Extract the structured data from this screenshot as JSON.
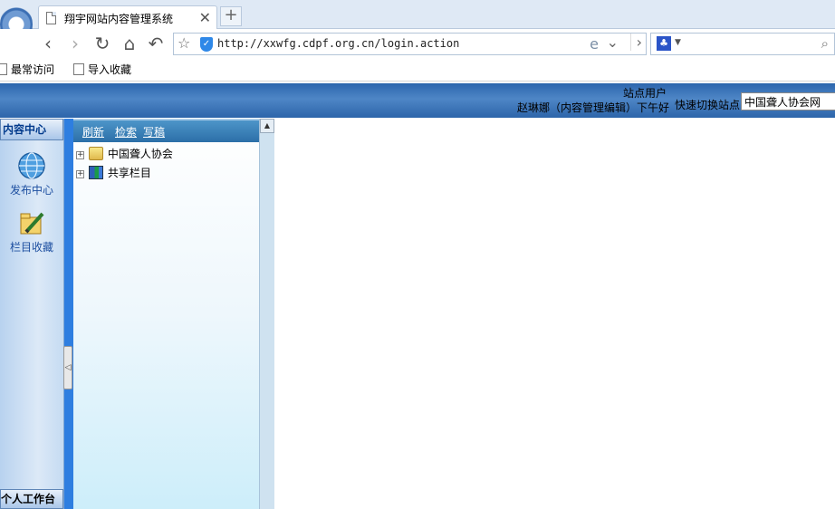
{
  "browser": {
    "tab_title": "翔宇网站内容管理系统",
    "tab_close": "✕",
    "new_tab": "+",
    "url": "http://xxwfg.cdpf.org.cn/login.action",
    "nav": {
      "back": "‹",
      "forward": "›",
      "reload": "↻",
      "home": "⌂",
      "undo": "↶"
    },
    "bookmarks": [
      "最常访问",
      "导入收藏"
    ]
  },
  "header": {
    "user_label": "站点用户",
    "greeting": "赵琳娜（内容管理编辑）下午好",
    "switch_label": "快速切换站点",
    "site_selected": "中国聋人协会网"
  },
  "left_rail": {
    "title": "内容中心",
    "items": [
      {
        "label": "发布中心",
        "icon": "globe-icon"
      },
      {
        "label": "栏目收藏",
        "icon": "pencil-folder-icon"
      }
    ],
    "bottom": "个人工作台"
  },
  "tree": {
    "toolbar": [
      "刷新",
      "检索",
      "写稿"
    ],
    "nodes": [
      {
        "label": "中国聋人协会",
        "icon": "folder-icon",
        "expander": "+"
      },
      {
        "label": "共享栏目",
        "icon": "shared-icon",
        "expander": "+"
      }
    ]
  },
  "colors": {
    "header_blue": "#2c66ad",
    "stripe_blue": "#2e7ee0",
    "rail_text": "#1d4fa0"
  }
}
